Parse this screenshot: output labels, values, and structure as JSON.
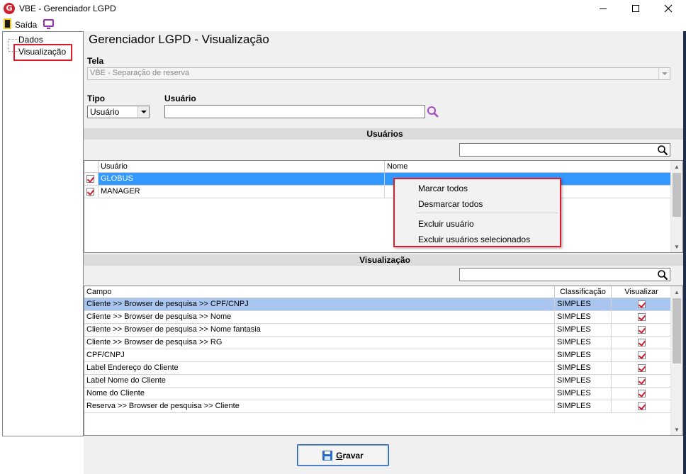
{
  "window": {
    "title": "VBE - Gerenciador LGPD",
    "logo_letter": "G"
  },
  "toolbar": {
    "exit_label": "Saída"
  },
  "tree": {
    "items": [
      "Dados",
      "Visualização"
    ]
  },
  "page": {
    "title": "Gerenciador LGPD - Visualização",
    "tela_label": "Tela",
    "tela_value": "VBE - Separação de reserva",
    "tipo_label": "Tipo",
    "tipo_value": "Usuário",
    "usuario_label": "Usuário",
    "usuario_value": ""
  },
  "users_section": {
    "header": "Usuários",
    "columns": [
      "Usuário",
      "Nome"
    ],
    "rows": [
      {
        "usuario": "GLOBUS",
        "nome": "",
        "checked": true,
        "selected": true
      },
      {
        "usuario": "MANAGER",
        "nome": "",
        "checked": true,
        "selected": false
      }
    ]
  },
  "context_menu": {
    "items": [
      "Marcar todos",
      "Desmarcar todos",
      "Excluir usuário",
      "Excluir usuários selecionados"
    ]
  },
  "viz_section": {
    "header": "Visualização",
    "columns": [
      "Campo",
      "Classificação",
      "Visualizar"
    ],
    "rows": [
      {
        "campo": "Cliente >> Browser de pesquisa >> CPF/CNPJ",
        "classificacao": "SIMPLES",
        "visualizar": true
      },
      {
        "campo": "Cliente >> Browser de pesquisa >> Nome",
        "classificacao": "SIMPLES",
        "visualizar": true
      },
      {
        "campo": "Cliente >> Browser de pesquisa >> Nome fantasia",
        "classificacao": "SIMPLES",
        "visualizar": true
      },
      {
        "campo": "Cliente >> Browser de pesquisa >> RG",
        "classificacao": "SIMPLES",
        "visualizar": true
      },
      {
        "campo": "CPF/CNPJ",
        "classificacao": "SIMPLES",
        "visualizar": true
      },
      {
        "campo": "Label Endereço do Cliente",
        "classificacao": "SIMPLES",
        "visualizar": true
      },
      {
        "campo": "Label Nome do Cliente",
        "classificacao": "SIMPLES",
        "visualizar": true
      },
      {
        "campo": "Nome do Cliente",
        "classificacao": "SIMPLES",
        "visualizar": true
      },
      {
        "campo": "Reserva >> Browser de pesquisa >> Cliente",
        "classificacao": "SIMPLES",
        "visualizar": true
      }
    ]
  },
  "footer": {
    "save_label_first": "G",
    "save_label_rest": "ravar"
  },
  "colors": {
    "highlight": "#e0192b",
    "selection": "#3399ff",
    "selection_light": "#a8c6f0"
  }
}
